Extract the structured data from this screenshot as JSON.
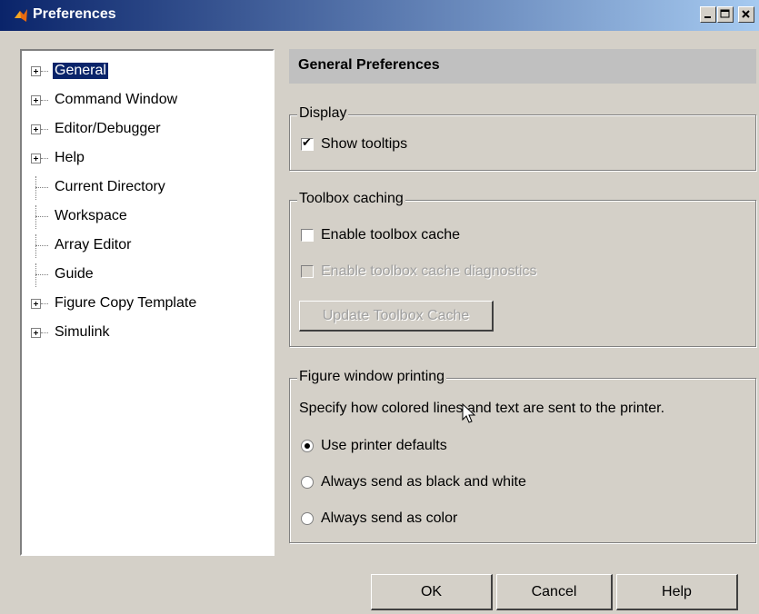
{
  "window": {
    "title": "Preferences"
  },
  "tree": {
    "items": [
      {
        "label": "General",
        "expandable": true,
        "selected": true
      },
      {
        "label": "Command Window",
        "expandable": true
      },
      {
        "label": "Editor/Debugger",
        "expandable": true
      },
      {
        "label": "Help",
        "expandable": true
      },
      {
        "label": "Current Directory",
        "expandable": false
      },
      {
        "label": "Workspace",
        "expandable": false
      },
      {
        "label": "Array Editor",
        "expandable": false
      },
      {
        "label": "Guide",
        "expandable": false
      },
      {
        "label": "Figure Copy Template",
        "expandable": true
      },
      {
        "label": "Simulink",
        "expandable": true
      }
    ]
  },
  "panel": {
    "header": "General Preferences",
    "display": {
      "legend": "Display",
      "show_tooltips": "Show tooltips",
      "show_tooltips_checked": true
    },
    "toolbox": {
      "legend": "Toolbox caching",
      "enable_cache": "Enable toolbox cache",
      "enable_cache_checked": false,
      "enable_diag": "Enable toolbox cache diagnostics",
      "enable_diag_checked": false,
      "update_button": "Update Toolbox Cache"
    },
    "printing": {
      "legend": "Figure window printing",
      "description": "Specify how colored lines and text are sent to the printer.",
      "options": [
        "Use printer defaults",
        "Always send as black and white",
        "Always send as color"
      ],
      "selected": "Use printer defaults"
    }
  },
  "buttons": {
    "ok": "OK",
    "cancel": "Cancel",
    "help": "Help"
  },
  "colors": {
    "titlebar_start": "#0a246a",
    "titlebar_end": "#a6caf0",
    "selection": "#0a246a",
    "face": "#d4d0c8"
  }
}
